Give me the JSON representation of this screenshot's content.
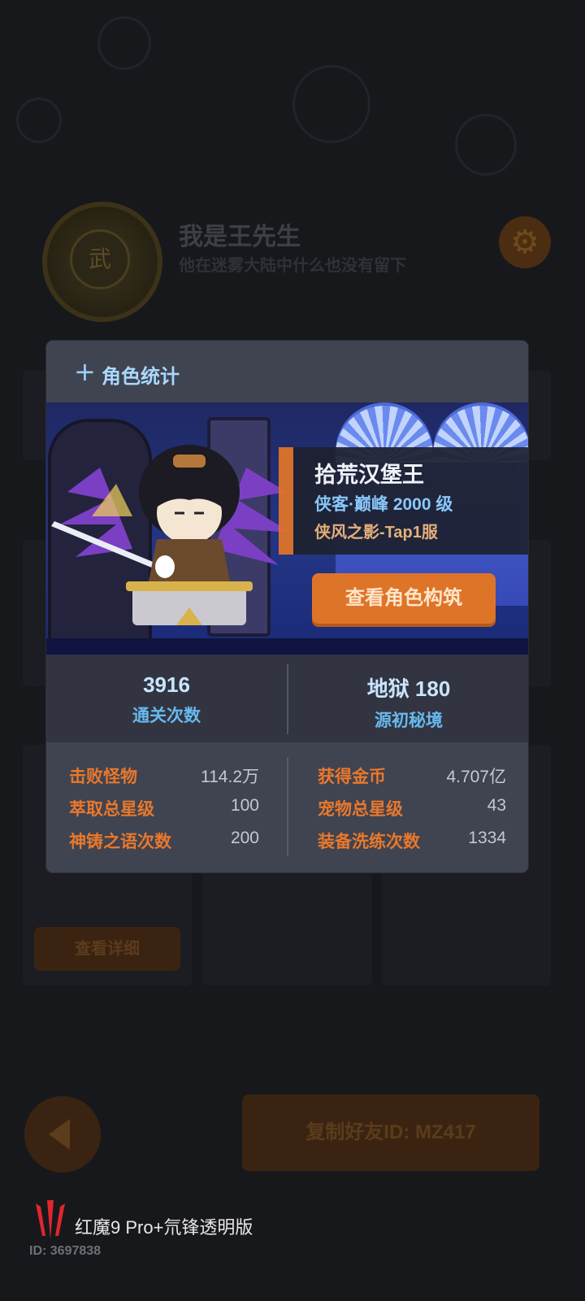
{
  "background": {
    "profile": {
      "medal_text": "武",
      "name": "我是王先生",
      "subtitle": "他在迷雾大陆中什么也没有留下"
    },
    "view_details_button": "查看详细",
    "copy_friend_button": "复制好友ID: MZ417"
  },
  "modal": {
    "title": "角色统计",
    "character": {
      "name": "拾荒汉堡王",
      "class_level": "侠客·巅峰 2000 级",
      "server": "侠风之影-Tap1服"
    },
    "build_button": "查看角色构筑",
    "top_stats": [
      {
        "value": "3916",
        "label": "通关次数"
      },
      {
        "value": "地狱 180",
        "label": "源初秘境"
      }
    ],
    "left_stats": [
      {
        "label": "击败怪物",
        "value": "114.2万"
      },
      {
        "label": "萃取总星级",
        "value": "100"
      },
      {
        "label": "神铸之语次数",
        "value": "200"
      }
    ],
    "right_stats": [
      {
        "label": "获得金币",
        "value": "4.707亿"
      },
      {
        "label": "宠物总星级",
        "value": "43"
      },
      {
        "label": "装备洗练次数",
        "value": "1334"
      }
    ]
  },
  "watermark": {
    "device": "红魔9 Pro+氘锋透明版",
    "id": "ID: 3697838"
  },
  "colors": {
    "accent_orange": "#de7428",
    "stat_blue": "#67b9ee",
    "panel": "#404350"
  }
}
